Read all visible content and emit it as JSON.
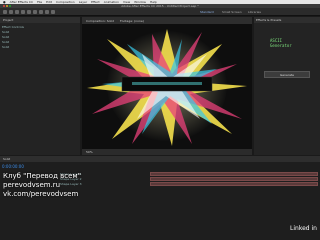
{
  "menubar": [
    "After Effects CC",
    "File",
    "Edit",
    "Composition",
    "Layer",
    "Effect",
    "Animation",
    "View",
    "Window",
    "Help"
  ],
  "window_title": "Adobe After Effects CC 2015 - Untitled Project.aep *",
  "workspace": {
    "tabs": [
      "Standard",
      "Small Screen",
      "Libraries"
    ]
  },
  "project_panel": {
    "title": "Project",
    "items": [
      "Effect Controls",
      "Solid",
      "Solid",
      "Solid",
      "Solid"
    ]
  },
  "comp_panel": {
    "tabs": [
      "Composition: Solid",
      "Footage: (none)"
    ],
    "zoom": "50%"
  },
  "ascii": {
    "logo_line1": "ASCII",
    "logo_line2": "Generator",
    "button": "Generate"
  },
  "right_panel": {
    "title": "Effects & Presets"
  },
  "timeline": {
    "title": "Solid",
    "timecode": "0:00:00:00",
    "layers": [
      "Shape Layer 1",
      "Shape Layer 2",
      "Shape Layer 3"
    ]
  },
  "watermark": {
    "lines": [
      "Клуб \"Перевод всем\"",
      "perevodvsem.ru",
      "vk.com/perevodvsem"
    ]
  },
  "brand": "Linked in"
}
